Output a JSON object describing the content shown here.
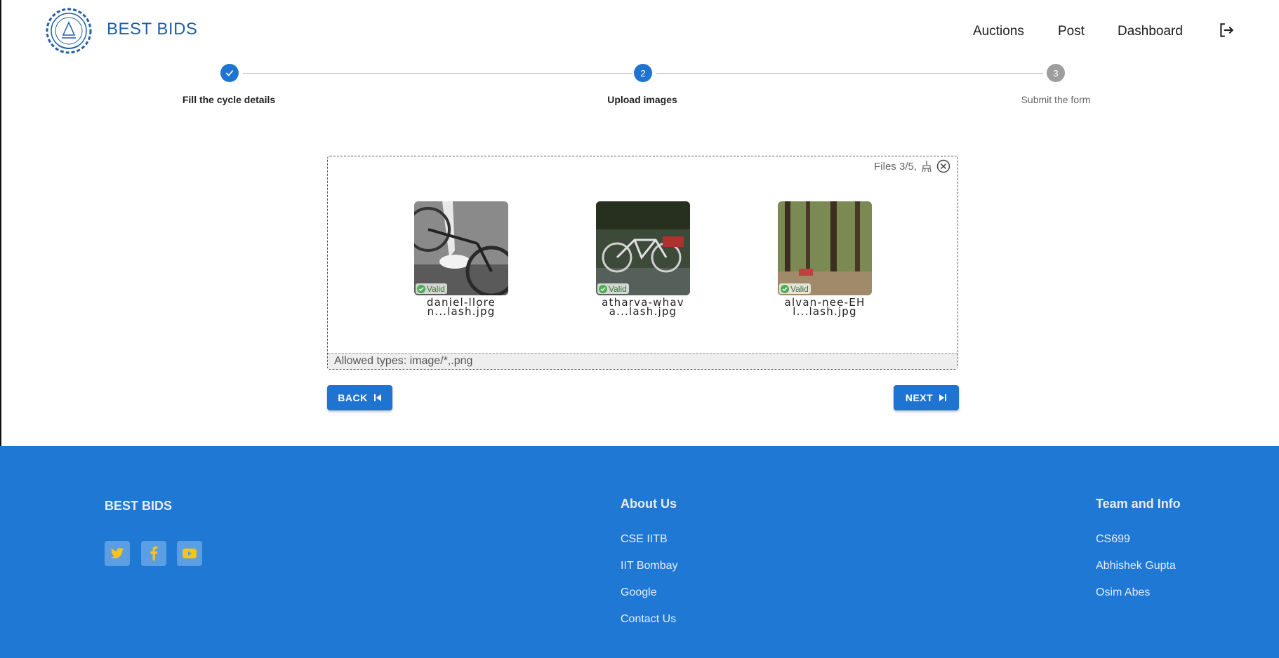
{
  "header": {
    "brand": "BEST BIDS",
    "nav": [
      "Auctions",
      "Post",
      "Dashboard"
    ]
  },
  "stepper": {
    "steps": [
      {
        "label": "Fill the cycle details",
        "state": "completed",
        "number": "1"
      },
      {
        "label": "Upload images",
        "state": "active",
        "number": "2"
      },
      {
        "label": "Submit the form",
        "state": "pending",
        "number": "3"
      }
    ]
  },
  "uploader": {
    "files_count": "Files 3/5,",
    "files": [
      {
        "name_line1": "daniel-llore",
        "name_line2": "n...lash.jpg",
        "status": "Valid"
      },
      {
        "name_line1": "atharva-whav",
        "name_line2": "a...lash.jpg",
        "status": "Valid"
      },
      {
        "name_line1": "alvan-nee-EH",
        "name_line2": "l...lash.jpg",
        "status": "Valid"
      }
    ],
    "allowed_types": "Allowed types: image/*,.png"
  },
  "actions": {
    "back_label": "BACK",
    "next_label": "NEXT"
  },
  "footer": {
    "brand": "BEST BIDS",
    "about_heading": "About Us",
    "about_links": [
      "CSE IITB",
      "IIT Bombay",
      "Google",
      "Contact Us"
    ],
    "team_heading": "Team and Info",
    "team_links": [
      "CS699",
      "Abhishek Gupta",
      "Osim Abes"
    ],
    "social_icons": [
      "twitter-icon",
      "facebook-icon",
      "youtube-icon"
    ]
  },
  "colors": {
    "primary": "#1f74d1",
    "footer_bg": "#1f78d4",
    "social_icon": "#f5c518",
    "valid": "#4caf50"
  }
}
